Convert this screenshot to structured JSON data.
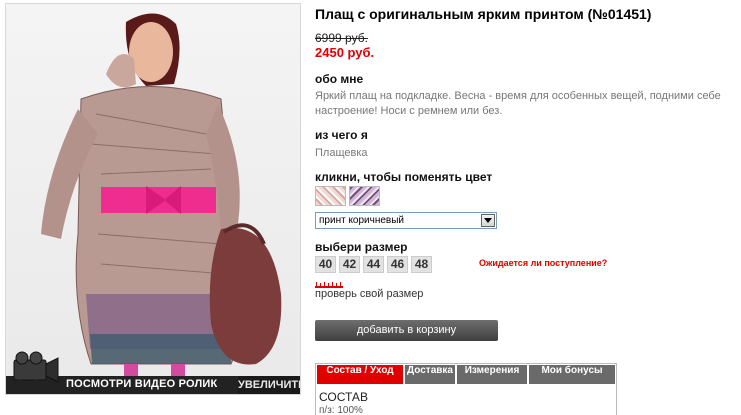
{
  "product": {
    "title": "Плащ с оригинальным ярким принтом (№01451)",
    "old_price": "6999 руб.",
    "new_price": "2450 руб."
  },
  "about": {
    "heading": "обо мне",
    "text": "Яркий плащ на подкладке. Весна - время для особенных вещей, подними себе настроение! Носи с ремнем или без."
  },
  "material": {
    "heading": "из чего я",
    "text": "Плащевка"
  },
  "color": {
    "heading": "кликни, чтобы поменять цвет",
    "swatches": [
      "принт коричневый",
      "принт фиолетовый"
    ],
    "selected": "принт коричневый"
  },
  "size": {
    "heading": "выбери размер",
    "options": [
      "40",
      "42",
      "44",
      "46",
      "48"
    ],
    "waiting_link": "Ожидается ли поступление?",
    "check_link": "проверь свой размер"
  },
  "cart_button": "добавить в корзину",
  "photo": {
    "video_label": "ПОСМОТРИ ВИДЕО РОЛИК",
    "zoom_label": "УВЕЛИЧИТЬ"
  },
  "tabs": {
    "items": [
      "Состав / Уход",
      "Доставка",
      "Измерения",
      "Мои бонусы"
    ],
    "active": 0,
    "content_title": "СОСТАВ",
    "content_text": "п/з: 100%"
  },
  "colors": {
    "accent": "#e00000",
    "button_dark": "#4a4a4a",
    "tab_gray": "#6a6a6a"
  }
}
